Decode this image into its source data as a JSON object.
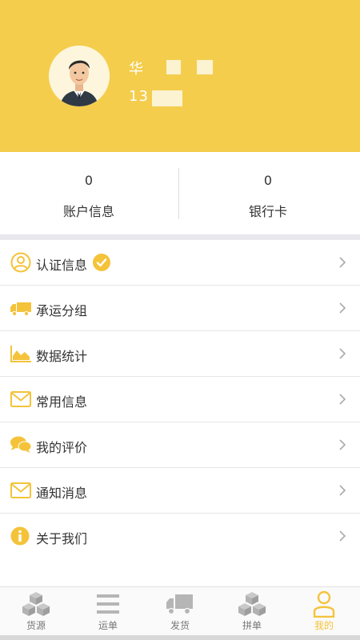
{
  "profile": {
    "name": "华",
    "phone": "13"
  },
  "stats": [
    {
      "value": "0",
      "label": "账户信息"
    },
    {
      "value": "0",
      "label": "银行卡"
    }
  ],
  "menu": [
    {
      "label": "认证信息",
      "icon": "user-circle-icon"
    },
    {
      "label": "承运分组",
      "icon": "truck-icon"
    },
    {
      "label": "数据统计",
      "icon": "area-chart-icon"
    },
    {
      "label": "常用信息",
      "icon": "envelope-icon"
    },
    {
      "label": "我的评价",
      "icon": "chat-bubbles-icon"
    },
    {
      "label": "通知消息",
      "icon": "envelope-icon"
    },
    {
      "label": "关于我们",
      "icon": "info-icon"
    }
  ],
  "tabs": [
    {
      "label": "货源",
      "icon": "boxes-icon"
    },
    {
      "label": "运单",
      "icon": "list-icon"
    },
    {
      "label": "发货",
      "icon": "truck-icon"
    },
    {
      "label": "拼单",
      "icon": "boxes-icon"
    },
    {
      "label": "我的",
      "icon": "person-icon",
      "active": true
    }
  ],
  "colors": {
    "accent": "#f4cd4d",
    "accent_dark": "#f4c33a",
    "tab_inactive": "#b5b5b5"
  }
}
